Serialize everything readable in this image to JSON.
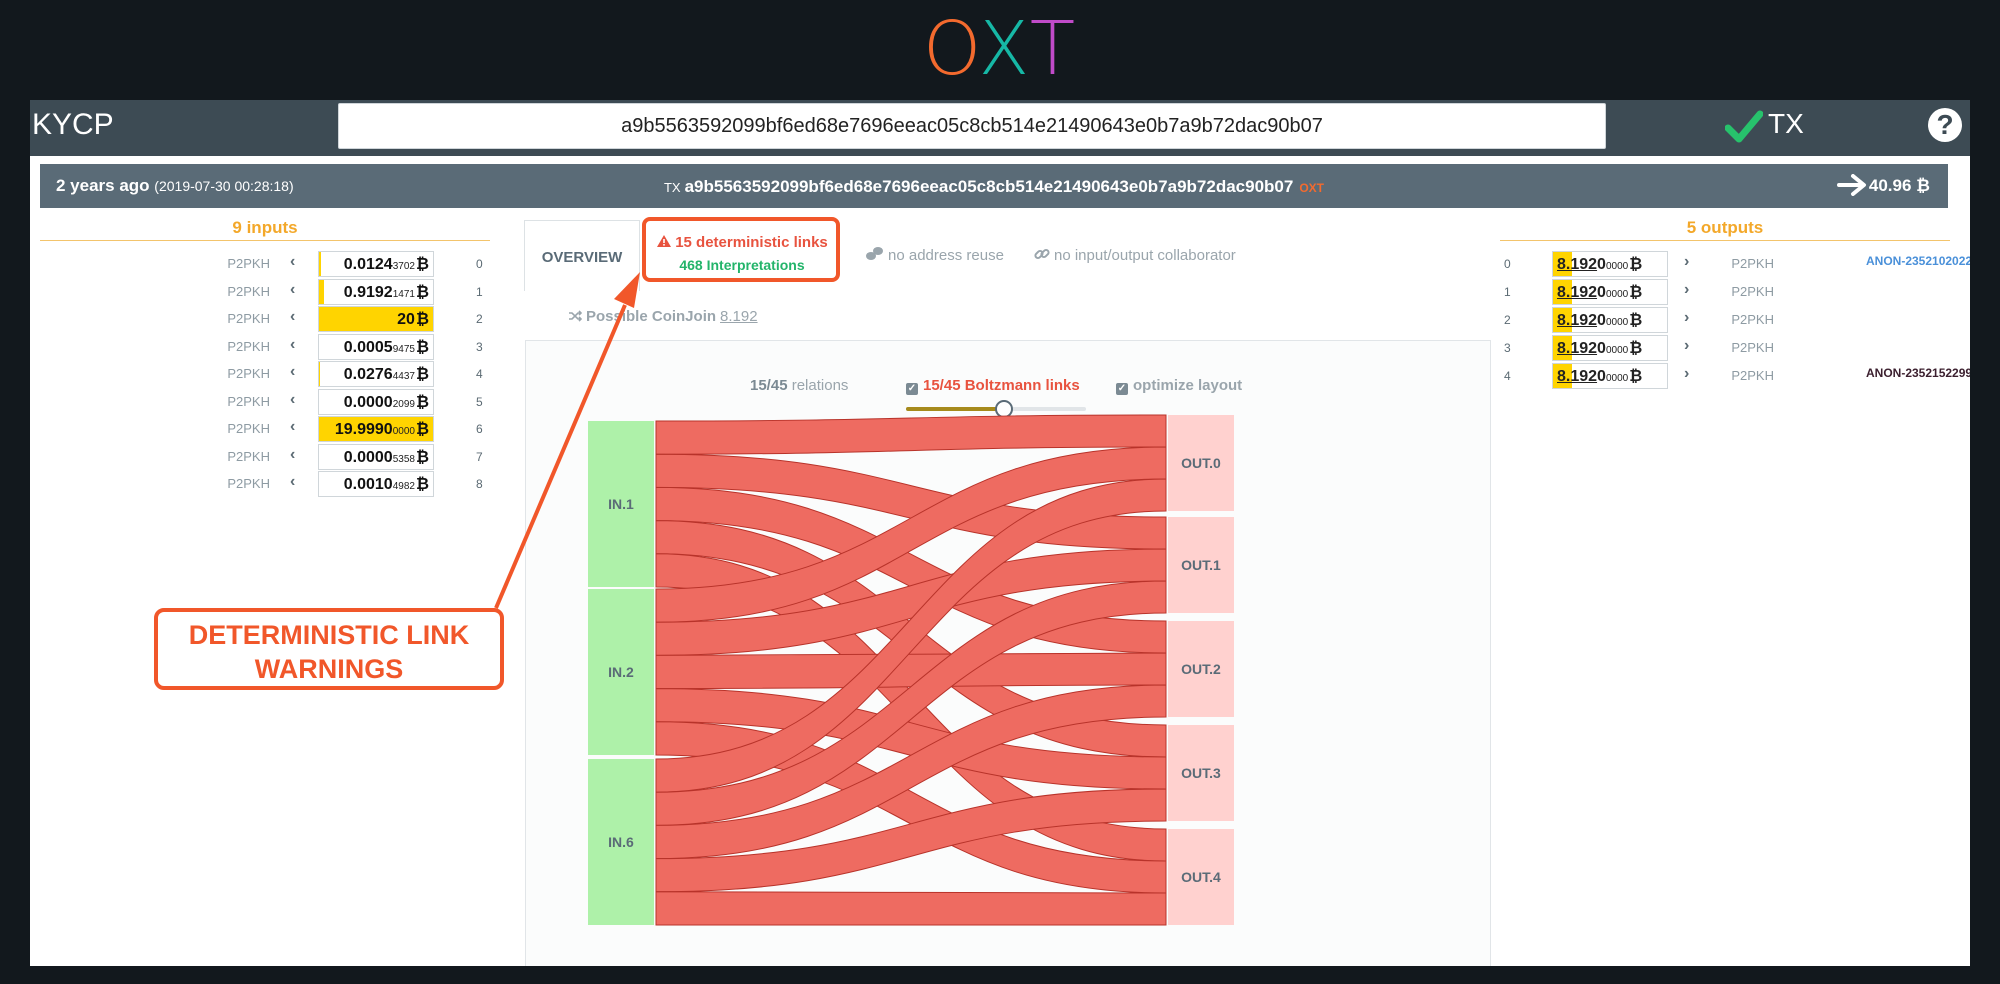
{
  "logo": {
    "c0": "O",
    "c1": "X",
    "c2": "T"
  },
  "topbar": {
    "brand": "KYCP",
    "search_value": "a9b5563592099bf6ed68e7696eeac05c8cb514e21490643e0b7a9b72dac90b07",
    "tx_label": "TX",
    "help": "?"
  },
  "txbar": {
    "age": "2 years ago",
    "date": "(2019-07-30 00:28:18)",
    "tx_prefix": "TX",
    "txid": "a9b5563592099bf6ed68e7696eeac05c8cb514e21490643e0b7a9b72dac90b07",
    "mini": "OXT",
    "total": "40.96 ₿"
  },
  "inputs": {
    "header": "9 inputs",
    "rows": [
      {
        "type": "P2PKH",
        "main": "0.0124",
        "sub": "3702",
        "idx": "0",
        "fill": 0.02
      },
      {
        "type": "P2PKH",
        "main": "0.9192",
        "sub": "1471",
        "idx": "1",
        "fill": 0.046
      },
      {
        "type": "P2PKH",
        "main": "20",
        "sub": "",
        "idx": "2",
        "fill": 1.0
      },
      {
        "type": "P2PKH",
        "main": "0.0005",
        "sub": "9475",
        "idx": "3",
        "fill": 0.0
      },
      {
        "type": "P2PKH",
        "main": "0.0276",
        "sub": "4437",
        "idx": "4",
        "fill": 0.01
      },
      {
        "type": "P2PKH",
        "main": "0.0000",
        "sub": "2099",
        "idx": "5",
        "fill": 0.0
      },
      {
        "type": "P2PKH",
        "main": "19.9990",
        "sub": "0000",
        "idx": "6",
        "fill": 1.0
      },
      {
        "type": "P2PKH",
        "main": "0.0000",
        "sub": "5358",
        "idx": "7",
        "fill": 0.0
      },
      {
        "type": "P2PKH",
        "main": "0.0010",
        "sub": "4982",
        "idx": "8",
        "fill": 0.0
      }
    ]
  },
  "outputs": {
    "header": "5 outputs",
    "rows": [
      {
        "idx": "0",
        "sig": "8.192",
        "rest": "0",
        "sub": "0000",
        "type": "P2PKH",
        "anon": "ANON-2352102022",
        "anon_color": "#4a90d9"
      },
      {
        "idx": "1",
        "sig": "8.192",
        "rest": "0",
        "sub": "0000",
        "type": "P2PKH",
        "anon": "",
        "anon_color": "#4a90d9"
      },
      {
        "idx": "2",
        "sig": "8.192",
        "rest": "0",
        "sub": "0000",
        "type": "P2PKH",
        "anon": "",
        "anon_color": "#4a90d9"
      },
      {
        "idx": "3",
        "sig": "8.192",
        "rest": "0",
        "sub": "0000",
        "type": "P2PKH",
        "anon": "",
        "anon_color": "#4a90d9"
      },
      {
        "idx": "4",
        "sig": "8.192",
        "rest": "0",
        "sub": "0000",
        "type": "P2PKH",
        "anon": "ANON-2352152299",
        "anon_color": "#3b1f2e"
      }
    ]
  },
  "tabs": {
    "overview": "OVERVIEW",
    "det_links": "15 deterministic links",
    "interpretations": "468 Interpretations",
    "reuse": "no address reuse",
    "collab": "no input/output collaborator"
  },
  "coinjoin": {
    "label": "Possible CoinJoin",
    "amount": "8.192"
  },
  "graph": {
    "relations_count": "15/45",
    "relations_label": "relations",
    "boltzmann": "15/45 Boltzmann links",
    "optimize": "optimize layout",
    "inputs": [
      "IN.1",
      "IN.2",
      "IN.6"
    ],
    "outputs": [
      "OUT.0",
      "OUT.1",
      "OUT.2",
      "OUT.3",
      "OUT.4"
    ],
    "slider_fraction": 0.54,
    "colors": {
      "input": "#aef1a9",
      "output": "#ffd1cf",
      "link": "#ee6b61",
      "link_stroke": "#b8332a"
    }
  },
  "callout": {
    "line1": "DETERMINISTIC LINK",
    "line2": "WARNINGS"
  },
  "colors": {
    "accent": "#f1572a",
    "topbar": "#3d4b54",
    "txbar": "#5a6b77"
  }
}
